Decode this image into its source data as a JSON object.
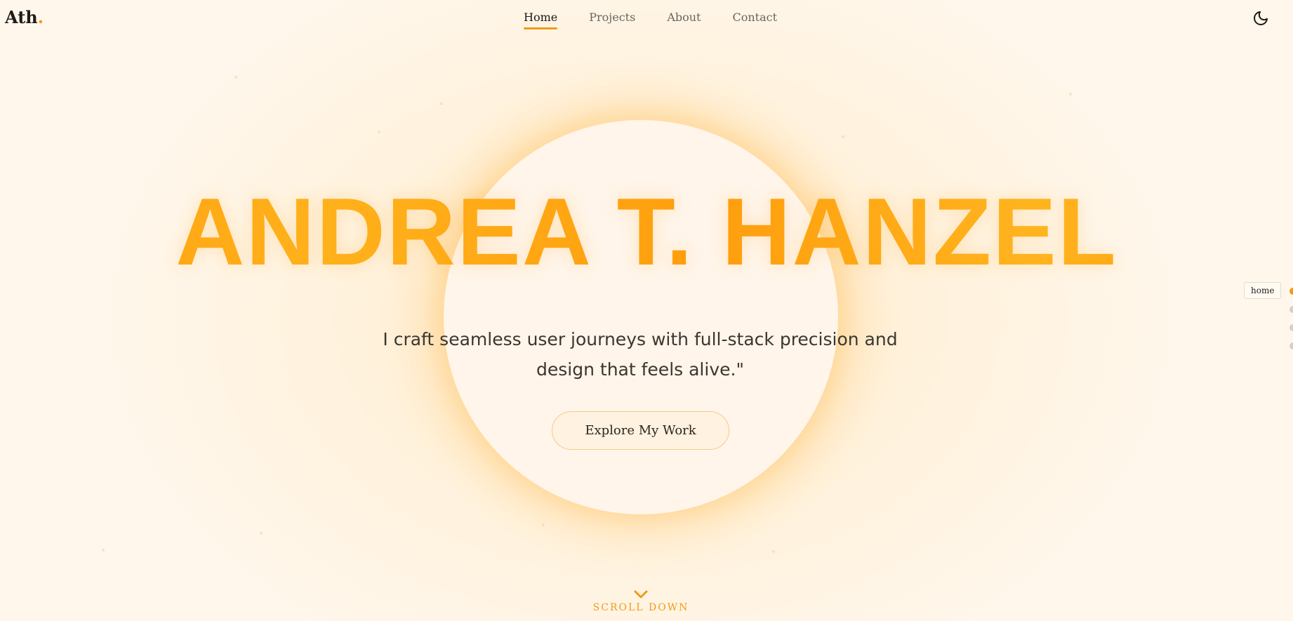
{
  "header": {
    "logo_text": "Ath",
    "logo_dot": ".",
    "nav": [
      {
        "label": "Home",
        "active": true
      },
      {
        "label": "Projects",
        "active": false
      },
      {
        "label": "About",
        "active": false
      },
      {
        "label": "Contact",
        "active": false
      }
    ],
    "theme_icon": "moon-icon"
  },
  "hero": {
    "name": "ANDREA T. HANZEL",
    "tagline": "I craft seamless user journeys with full-stack precision and design that feels alive.\"",
    "cta_label": "Explore My Work"
  },
  "scroll": {
    "label": "SCROLL DOWN",
    "icon": "chevron-down-icon"
  },
  "side_nav": {
    "tooltip": "home",
    "sections": [
      "home",
      "projects",
      "about",
      "contact"
    ],
    "active_index": 0
  },
  "colors": {
    "accent": "#f29a16",
    "background": "#fff6ea",
    "text": "#1e1a16"
  }
}
